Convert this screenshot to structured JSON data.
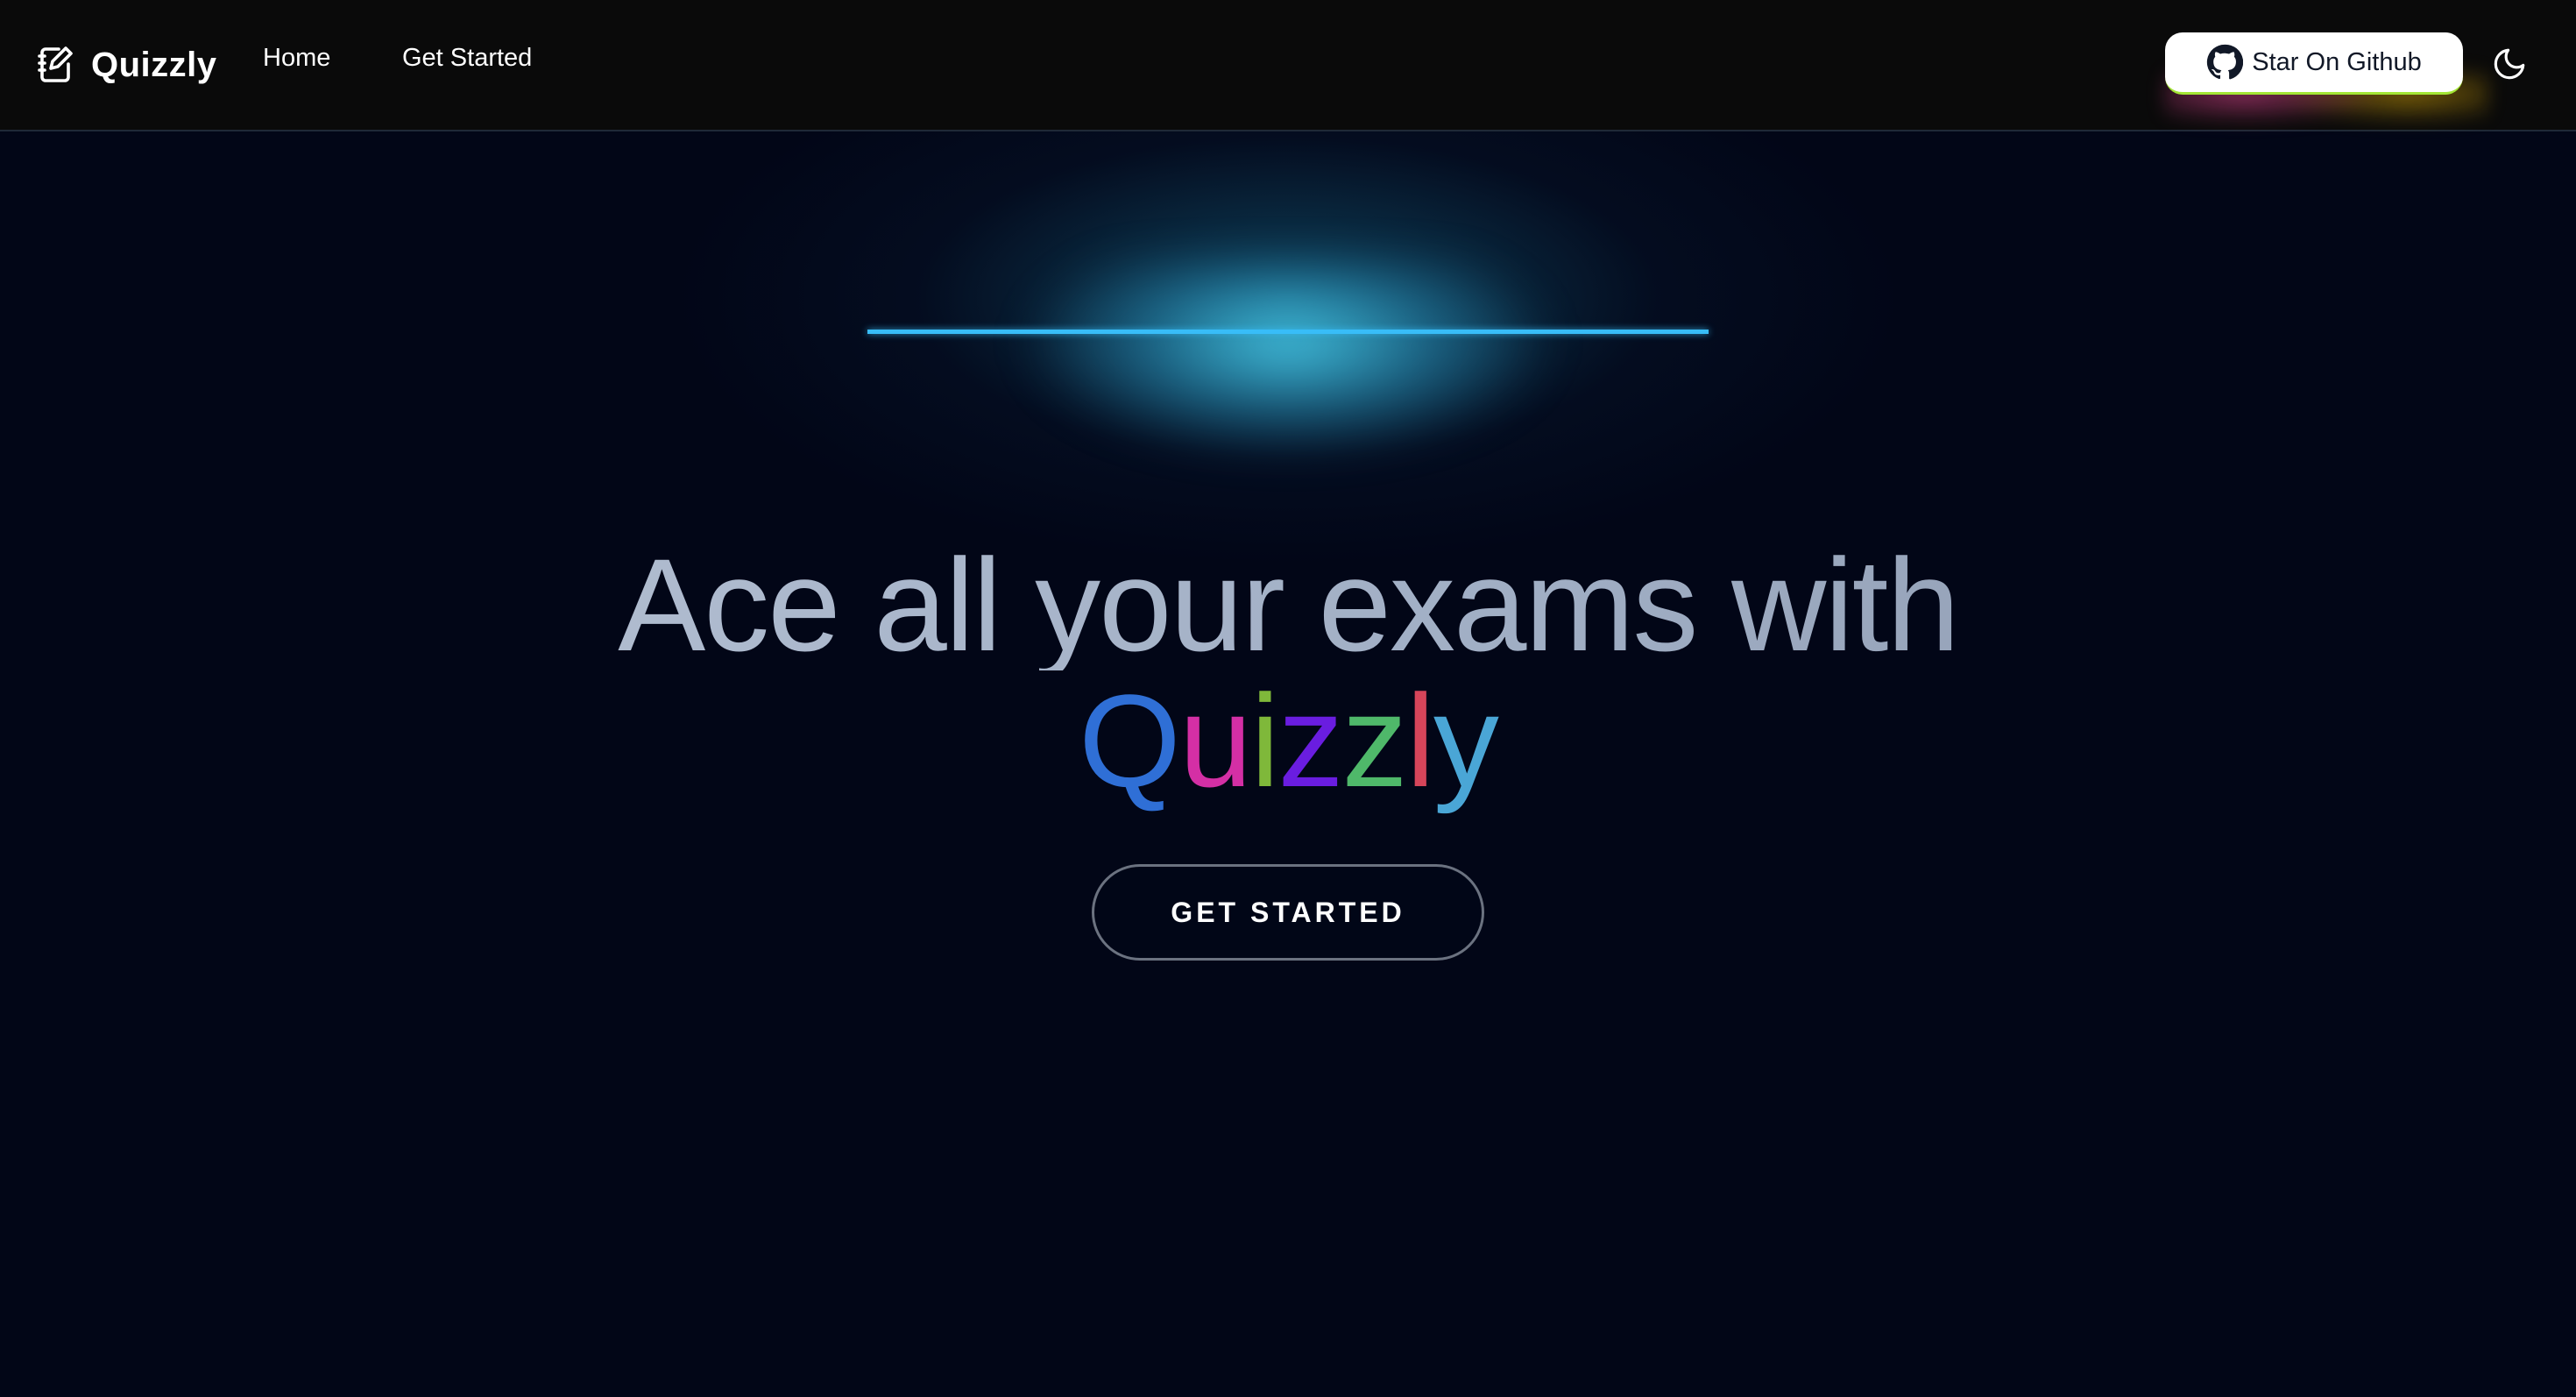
{
  "navbar": {
    "brand_name": "Quizzly",
    "links": [
      "Home",
      "Get Started"
    ],
    "github_button_label": "Star On Github"
  },
  "hero": {
    "headline": "Ace all your exams with",
    "brand_word": "Quizzly",
    "brand_letters": [
      {
        "char": "Q",
        "color": "#2f6fd6"
      },
      {
        "char": "u",
        "color": "#d42fa5"
      },
      {
        "char": "i",
        "color": "#7fb83a"
      },
      {
        "char": "z",
        "color": "#6a1de0"
      },
      {
        "char": "z",
        "color": "#4fb86a"
      },
      {
        "char": "l",
        "color": "#d6455a"
      },
      {
        "char": "y",
        "color": "#4aa6d6"
      }
    ],
    "cta_label": "GET STARTED"
  },
  "colors": {
    "background": "#020617",
    "navbar_background": "#0a0a0a",
    "accent_glow": "#38bdf8"
  },
  "icons": {
    "brand": "edit-note-icon",
    "github": "github-icon",
    "theme": "moon-icon"
  }
}
